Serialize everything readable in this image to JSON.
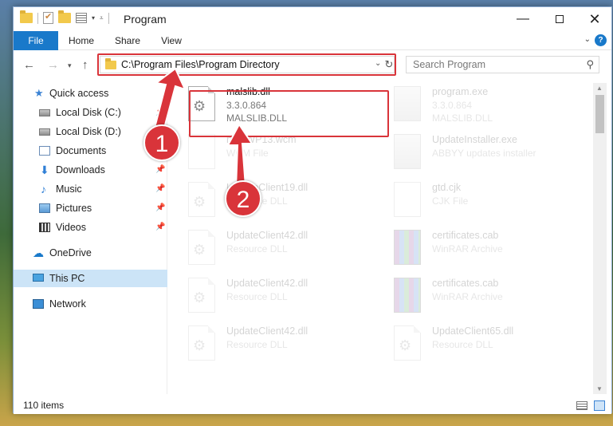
{
  "window": {
    "title": "Program",
    "controls": {
      "minimize": "—",
      "maximize": "",
      "close": "✕"
    }
  },
  "ribbon": {
    "tabs": [
      {
        "label": "File"
      },
      {
        "label": "Home"
      },
      {
        "label": "Share"
      },
      {
        "label": "View"
      }
    ],
    "help": "?"
  },
  "address": {
    "path": "C:\\Program Files\\Program Directory",
    "search_placeholder": "Search Program"
  },
  "sidebar": {
    "items": [
      {
        "label": "Quick access",
        "icon": "star-icon",
        "pinned": false
      },
      {
        "label": "Local Disk (C:)",
        "icon": "disk-icon",
        "pinned": true
      },
      {
        "label": "Local Disk (D:)",
        "icon": "disk-icon",
        "pinned": true
      },
      {
        "label": "Documents",
        "icon": "documents-icon",
        "pinned": true
      },
      {
        "label": "Downloads",
        "icon": "downloads-icon",
        "pinned": true
      },
      {
        "label": "Music",
        "icon": "music-icon",
        "pinned": true
      },
      {
        "label": "Pictures",
        "icon": "pictures-icon",
        "pinned": true
      },
      {
        "label": "Videos",
        "icon": "videos-icon",
        "pinned": true
      },
      {
        "label": "OneDrive",
        "icon": "cloud-icon",
        "pinned": false
      },
      {
        "label": "This PC",
        "icon": "computer-icon",
        "pinned": false,
        "selected": true
      },
      {
        "label": "Network",
        "icon": "network-icon",
        "pinned": false
      }
    ]
  },
  "files": [
    {
      "name": "malslib.dll",
      "line1": "3.3.0.864",
      "line2": "MALSLIB.DLL",
      "icon": "dll-icon",
      "highlighted": true
    },
    {
      "name": "program.exe",
      "line1": "3.3.0.864",
      "line2": "MALSLIB.DLL",
      "icon": "exe-icon"
    },
    {
      "name": "rfxfoWP13.wcm",
      "line1": "WCM File",
      "line2": "",
      "icon": "blank-file-icon"
    },
    {
      "name": "UpdateInstaller.exe",
      "line1": "ABBYY updates installer",
      "line2": "",
      "icon": "installer-icon"
    },
    {
      "name": "UpdateClient19.dll",
      "line1": "Resource DLL",
      "line2": "",
      "icon": "dll-icon"
    },
    {
      "name": "gtd.cjk",
      "line1": "CJK File",
      "line2": "",
      "icon": "blank-file-icon"
    },
    {
      "name": "UpdateClient42.dll",
      "line1": "Resource DLL",
      "line2": "",
      "icon": "dll-icon"
    },
    {
      "name": "certificates.cab",
      "line1": "WinRAR Archive",
      "line2": "",
      "icon": "winrar-icon"
    },
    {
      "name": "UpdateClient42.dll",
      "line1": "Resource DLL",
      "line2": "",
      "icon": "dll-icon"
    },
    {
      "name": "certificates.cab",
      "line1": "WinRAR Archive",
      "line2": "",
      "icon": "winrar-icon"
    },
    {
      "name": "UpdateClient42.dll",
      "line1": "Resource DLL",
      "line2": "",
      "icon": "dll-icon"
    },
    {
      "name": "UpdateClient65.dll",
      "line1": "Resource DLL",
      "line2": "",
      "icon": "dll-icon"
    }
  ],
  "status": {
    "count": "110 items"
  },
  "annotations": {
    "badge1": "1",
    "badge2": "2",
    "accent": "#d9343a"
  }
}
